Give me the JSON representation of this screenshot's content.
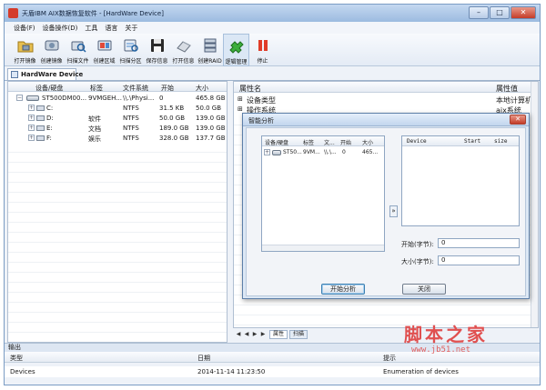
{
  "window": {
    "title": "天盾IBM AIX数据恢复软件 - [HardWare Device]",
    "min": "–",
    "max": "□",
    "close": "✕"
  },
  "menu": [
    "设备(F)",
    "设备操作(D)",
    "工具",
    "语言",
    "关于"
  ],
  "toolbar": [
    {
      "label": "打开镜像",
      "icon": "folder-disk-icon"
    },
    {
      "label": "创建镜像",
      "icon": "disk-icon"
    },
    {
      "label": "扫描文件",
      "icon": "disk-scan-icon"
    },
    {
      "label": "创建区域",
      "icon": "disk-region-icon"
    },
    {
      "label": "扫描分区",
      "icon": "partition-scan-icon"
    },
    {
      "label": "保存信息",
      "icon": "save-icon"
    },
    {
      "label": "打开信息",
      "icon": "open-info-icon"
    },
    {
      "label": "创建RAID",
      "icon": "raid-icon"
    },
    {
      "label": "逻辑管理",
      "icon": "logic-manage-icon"
    },
    {
      "label": "停止",
      "icon": "stop-icon"
    }
  ],
  "doc_tab": "HardWare Device",
  "device_tree": {
    "columns": [
      "设备/硬盘",
      "标签",
      "文件系统",
      "开始",
      "大小"
    ],
    "rows": [
      {
        "name": "ST500DM00...",
        "label": "9VMGEH...",
        "fs": "\\\\.\\Physi...",
        "start": "0",
        "size": "465.8 GB"
      },
      {
        "name": "C:",
        "label": "",
        "fs": "NTFS",
        "start": "31.5 KB",
        "size": "50.0 GB"
      },
      {
        "name": "D:",
        "label": "软件",
        "fs": "NTFS",
        "start": "50.0 GB",
        "size": "139.0 GB"
      },
      {
        "name": "E:",
        "label": "文档",
        "fs": "NTFS",
        "start": "189.0 GB",
        "size": "139.0 GB"
      },
      {
        "name": "F:",
        "label": "娱乐",
        "fs": "NTFS",
        "start": "328.0 GB",
        "size": "137.7 GB"
      }
    ]
  },
  "properties": {
    "col_name": "属性名",
    "col_value": "属性值",
    "rows": [
      {
        "name": "设备类型",
        "value": "本地计算机"
      },
      {
        "name": "操作系统",
        "value": "aix系统"
      }
    ]
  },
  "bottom_tabs": [
    "属性",
    "扫描"
  ],
  "output": {
    "title": "输出",
    "columns": [
      "类型",
      "日期",
      "提示"
    ],
    "rows": [
      {
        "type": "Devices",
        "date": "2014-11-14 11:23:50",
        "message": "Enumeration of devices"
      }
    ]
  },
  "dialog": {
    "title": "智能分析",
    "list_columns": [
      "设备/硬盘",
      "标签",
      "文...",
      "开始",
      "大小"
    ],
    "list_rows": [
      {
        "name": "ST50...",
        "label": "9VM...",
        "fs": "\\\\.\\...",
        "start": "0",
        "size": "465..."
      }
    ],
    "table_columns": [
      "Device",
      "Start",
      "size"
    ],
    "start_label": "开始(字节):",
    "start_value": "0",
    "size_label": "大小(字节):",
    "size_value": "0",
    "arrow": "»",
    "start_button": "开始分析",
    "close_button": "关闭"
  },
  "watermark": {
    "text": "脚本之家",
    "url": "www.jb51.net"
  }
}
